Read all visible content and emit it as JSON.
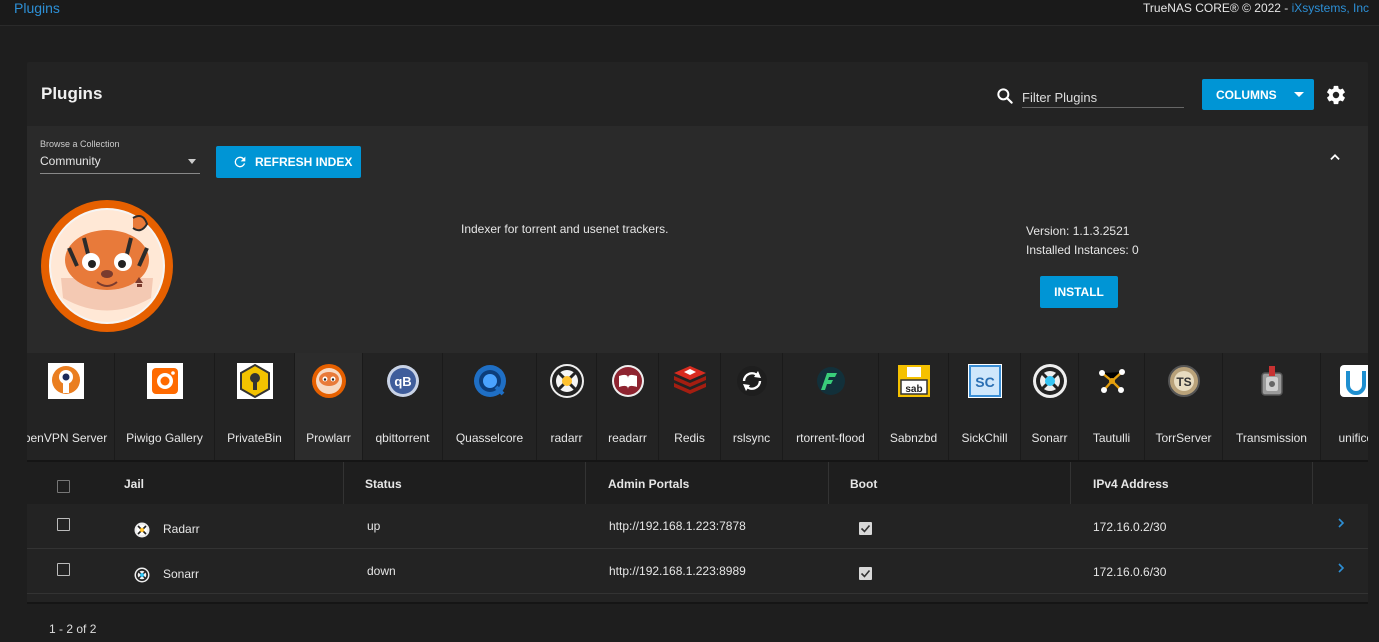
{
  "topbar": {
    "breadcrumb": "Plugins",
    "copyright": "TrueNAS CORE® © 2022 - ",
    "company": "iXsystems, Inc"
  },
  "header": {
    "title": "Plugins",
    "filter_placeholder": "Filter Plugins",
    "columns_label": "COLUMNS"
  },
  "collection": {
    "label": "Browse a Collection",
    "value": "Community",
    "refresh_label": "REFRESH INDEX"
  },
  "selected_plugin": {
    "description": "Indexer for torrent and usenet trackers.",
    "version": "Version: 1.1.3.2521",
    "installed": "Installed Instances: 0",
    "install_label": "INSTALL"
  },
  "plugins": [
    {
      "name": "penVPN Server",
      "icon": "openvpn-icon"
    },
    {
      "name": "Piwigo Gallery",
      "icon": "piwigo-icon"
    },
    {
      "name": "PrivateBin",
      "icon": "privatebin-icon"
    },
    {
      "name": "Prowlarr",
      "icon": "prowlarr-icon"
    },
    {
      "name": "qbittorrent",
      "icon": "qbittorrent-icon"
    },
    {
      "name": "Quasselcore",
      "icon": "quasselcore-icon"
    },
    {
      "name": "radarr",
      "icon": "radarr-icon"
    },
    {
      "name": "readarr",
      "icon": "readarr-icon"
    },
    {
      "name": "Redis",
      "icon": "redis-icon"
    },
    {
      "name": "rslsync",
      "icon": "rslsync-icon"
    },
    {
      "name": "rtorrent-flood",
      "icon": "flood-icon"
    },
    {
      "name": "Sabnzbd",
      "icon": "sabnzbd-icon"
    },
    {
      "name": "SickChill",
      "icon": "sickchill-icon"
    },
    {
      "name": "Sonarr",
      "icon": "sonarr-icon"
    },
    {
      "name": "Tautulli",
      "icon": "tautulli-icon"
    },
    {
      "name": "TorrServer",
      "icon": "torrserver-icon"
    },
    {
      "name": "Transmission",
      "icon": "transmission-icon"
    },
    {
      "name": "unificc",
      "icon": "unifi-icon"
    }
  ],
  "table": {
    "columns": [
      "Jail",
      "Status",
      "Admin Portals",
      "Boot",
      "IPv4 Address"
    ],
    "rows": [
      {
        "jail": "Radarr",
        "status": "up",
        "portal": "http://192.168.1.223:7878",
        "ipv4": "172.16.0.2/30",
        "boot": true
      },
      {
        "jail": "Sonarr",
        "status": "down",
        "portal": "http://192.168.1.223:8989",
        "ipv4": "172.16.0.6/30",
        "boot": true
      }
    ],
    "pagination": "1 - 2 of 2"
  },
  "colors": {
    "accent": "#0095d5",
    "link": "#2d8fd5",
    "background": "#1e1e1e",
    "card": "#232323"
  }
}
